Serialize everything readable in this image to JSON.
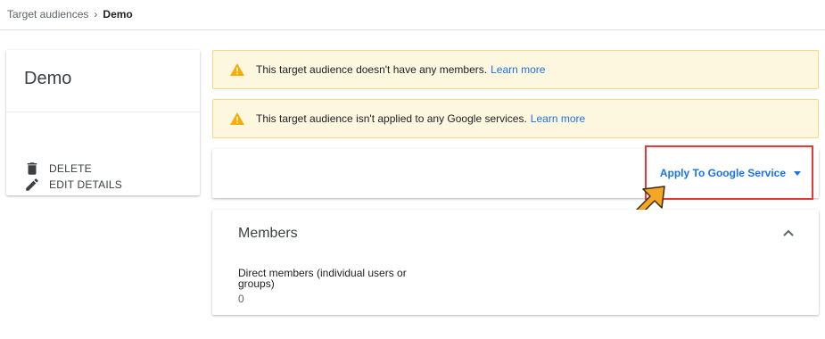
{
  "breadcrumb": {
    "parent": "Target audiences",
    "separator": "›",
    "current": "Demo"
  },
  "sidebar": {
    "title": "Demo",
    "actions": [
      {
        "label": "EDIT DETAILS",
        "icon": "pencil-icon"
      },
      {
        "label": "DELETE",
        "icon": "trash-icon"
      }
    ]
  },
  "alerts": [
    {
      "text": "This target audience doesn't have any members.",
      "link": "Learn more"
    },
    {
      "text": "This target audience isn't applied to any Google services.",
      "link": "Learn more"
    }
  ],
  "apply": {
    "label": "Apply To Google Service"
  },
  "members": {
    "title": "Members",
    "direct_label": "Direct members (individual users or groups)",
    "direct_count": "0"
  },
  "colors": {
    "accent": "#1a73e8",
    "warning": "#f9ab00",
    "alert_bg": "#fef7e0",
    "highlight": "#e53935",
    "arrow": "#f5a623"
  }
}
